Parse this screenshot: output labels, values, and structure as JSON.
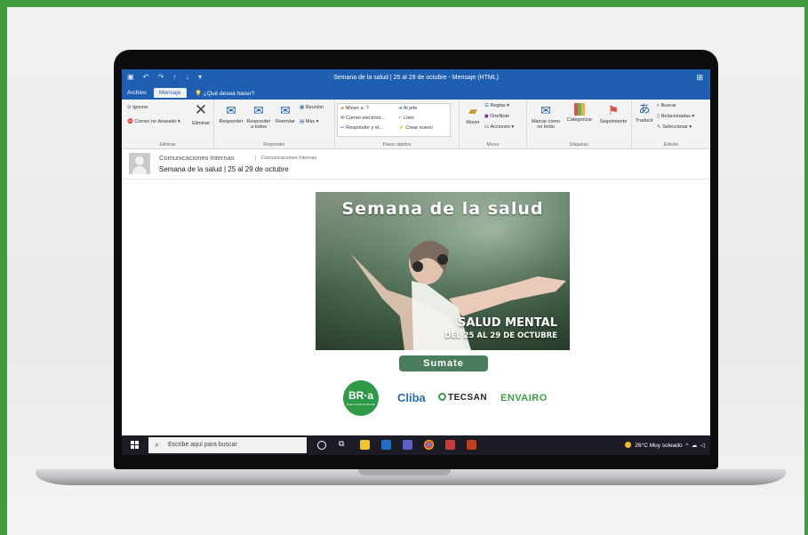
{
  "window": {
    "title": "Semana de la salud | 25 al 29 de octubre - Mensaje (HTML)"
  },
  "ribbon_tabs": [
    {
      "label": "Archivo"
    },
    {
      "label": "Mensaje"
    },
    {
      "label": "¿Qué desea hacer?"
    }
  ],
  "ribbon": {
    "eliminar": {
      "ignore": "Ignorar",
      "junk": "Correo no deseado",
      "delete": "Eliminar",
      "group": "Eliminar"
    },
    "responder": {
      "reply": "Responder",
      "reply_all": "Responder a todos",
      "forward": "Reenviar",
      "meeting": "Reunión",
      "more": "Más",
      "group": "Responder"
    },
    "pasos": {
      "move_to": "Mover a: ?",
      "to_manager": "Al jefe",
      "email": "Correo electróni...",
      "done": "Listo",
      "reply_del": "Responder y el...",
      "new": "Crear nuevo",
      "group": "Pasos rápidos"
    },
    "mover": {
      "move": "Mover",
      "rules": "Reglas",
      "onenote": "OneNote",
      "actions": "Acciones",
      "group": "Mover"
    },
    "etiquetas": {
      "mark_unread": "Marcar como no leído",
      "categorize": "Categorizar",
      "followup": "Seguimiento",
      "group": "Etiquetas"
    },
    "edicion": {
      "translate": "Traducir",
      "find": "Buscar",
      "related": "Relacionadas",
      "select": "Seleccionar",
      "group": "Edición"
    }
  },
  "message": {
    "sender": "Comunicaciones Internas",
    "sender_to": "Comunicaciones Internas",
    "subject": "Semana de la salud | 25 al 29 de octubre"
  },
  "banner": {
    "title": "Semana de la salud",
    "line1": "SALUD MENTAL",
    "line2": "DEL 25 AL 29 DE OCTUBRE"
  },
  "cta": {
    "label": "Sumate"
  },
  "logos": {
    "bra": "BR·a",
    "bra_tag": "Buenos Aires Ambiental",
    "cliba": "Cliba",
    "tecsan": "TECSAN",
    "envairo": "ENVAIRO"
  },
  "taskbar": {
    "search_placeholder": "Escribe aquí para buscar",
    "weather": "26°C Muy soleado"
  },
  "colors": {
    "frame_green": "#3e9a3c",
    "outlook_blue": "#1f5fb1",
    "cta_green": "#4a7d5e",
    "taskbar": "#1c1c26"
  }
}
